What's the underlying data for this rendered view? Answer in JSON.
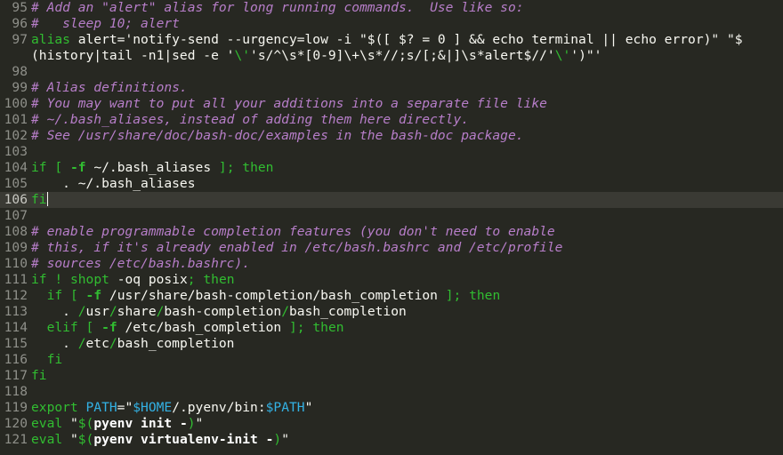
{
  "editor": {
    "language": "bash",
    "current_line": 106,
    "colors": {
      "background": "#272822",
      "current_line_bg": "#3a3a34",
      "gutter_text": "#8f908a",
      "text": "#f8f8f2",
      "comment": "#b77ec9",
      "keyword": "#31bd31",
      "string_literal": "#dcdcaa",
      "variable": "#33b2e5",
      "command_bold": "#ffffff"
    }
  },
  "lines": [
    {
      "num": "95",
      "segments": [
        {
          "t": "comment",
          "text": "# Add an \"alert\" alias for long running commands.  Use like so:"
        }
      ]
    },
    {
      "num": "96",
      "segments": [
        {
          "t": "comment",
          "text": "#   sleep 10; alert"
        }
      ]
    },
    {
      "num": "97",
      "segments": [
        {
          "t": "keyword",
          "text": "alias"
        },
        {
          "t": "plain",
          "text": " alert='notify-send --urgency=low -i \"$([ $? = 0 ] && echo terminal || echo error)\" \"$"
        }
      ]
    },
    {
      "num": "",
      "segments": [
        {
          "t": "plain",
          "text": "(history|tail -n1|sed -e '"
        },
        {
          "t": "keyword",
          "text": "\\'"
        },
        {
          "t": "plain",
          "text": "'s/^\\s*[0-9]\\+\\s*//;s/[;&|]\\s*alert$//'"
        },
        {
          "t": "keyword",
          "text": "\\'"
        },
        {
          "t": "plain",
          "text": "')\"'"
        }
      ]
    },
    {
      "num": "98",
      "segments": []
    },
    {
      "num": "99",
      "segments": [
        {
          "t": "comment",
          "text": "# Alias definitions."
        }
      ]
    },
    {
      "num": "100",
      "segments": [
        {
          "t": "comment",
          "text": "# You may want to put all your additions into a separate file like"
        }
      ]
    },
    {
      "num": "101",
      "segments": [
        {
          "t": "comment",
          "text": "# ~/.bash_aliases, instead of adding them here directly."
        }
      ]
    },
    {
      "num": "102",
      "segments": [
        {
          "t": "comment",
          "text": "# See /usr/share/doc/bash-doc/examples in the bash-doc package."
        }
      ]
    },
    {
      "num": "103",
      "segments": []
    },
    {
      "num": "104",
      "segments": [
        {
          "t": "keyword",
          "text": "if"
        },
        {
          "t": "plain",
          "text": " "
        },
        {
          "t": "keyword",
          "text": "["
        },
        {
          "t": "plain",
          "text": " "
        },
        {
          "t": "flag",
          "text": "-f"
        },
        {
          "t": "plain",
          "text": " ~/.bash_aliases "
        },
        {
          "t": "keyword",
          "text": "];"
        },
        {
          "t": "plain",
          "text": " "
        },
        {
          "t": "keyword",
          "text": "then"
        }
      ]
    },
    {
      "num": "105",
      "segments": [
        {
          "t": "plain",
          "text": "    . ~/.bash_aliases"
        }
      ]
    },
    {
      "num": "106",
      "segments": [
        {
          "t": "keyword",
          "text": "fi"
        }
      ]
    },
    {
      "num": "107",
      "segments": []
    },
    {
      "num": "108",
      "segments": [
        {
          "t": "comment",
          "text": "# enable programmable completion features (you don't need to enable"
        }
      ]
    },
    {
      "num": "109",
      "segments": [
        {
          "t": "comment",
          "text": "# this, if it's already enabled in /etc/bash.bashrc and /etc/profile"
        }
      ]
    },
    {
      "num": "110",
      "segments": [
        {
          "t": "comment",
          "text": "# sources /etc/bash.bashrc)."
        }
      ]
    },
    {
      "num": "111",
      "segments": [
        {
          "t": "keyword",
          "text": "if"
        },
        {
          "t": "plain",
          "text": " "
        },
        {
          "t": "keyword",
          "text": "!"
        },
        {
          "t": "plain",
          "text": " "
        },
        {
          "t": "keyword",
          "text": "shopt"
        },
        {
          "t": "plain",
          "text": " -oq posix"
        },
        {
          "t": "keyword",
          "text": ";"
        },
        {
          "t": "plain",
          "text": " "
        },
        {
          "t": "keyword",
          "text": "then"
        }
      ]
    },
    {
      "num": "112",
      "segments": [
        {
          "t": "plain",
          "text": "  "
        },
        {
          "t": "keyword",
          "text": "if"
        },
        {
          "t": "plain",
          "text": " "
        },
        {
          "t": "keyword",
          "text": "["
        },
        {
          "t": "plain",
          "text": " "
        },
        {
          "t": "flag",
          "text": "-f"
        },
        {
          "t": "plain",
          "text": " /usr/share/bash-completion/bash_completion "
        },
        {
          "t": "keyword",
          "text": "];"
        },
        {
          "t": "plain",
          "text": " "
        },
        {
          "t": "keyword",
          "text": "then"
        }
      ]
    },
    {
      "num": "113",
      "segments": [
        {
          "t": "plain",
          "text": "    . "
        },
        {
          "t": "keyword",
          "text": "/"
        },
        {
          "t": "plain",
          "text": "usr"
        },
        {
          "t": "keyword",
          "text": "/"
        },
        {
          "t": "plain",
          "text": "share"
        },
        {
          "t": "keyword",
          "text": "/"
        },
        {
          "t": "plain",
          "text": "bash-completion"
        },
        {
          "t": "keyword",
          "text": "/"
        },
        {
          "t": "plain",
          "text": "bash_completion"
        }
      ]
    },
    {
      "num": "114",
      "segments": [
        {
          "t": "plain",
          "text": "  "
        },
        {
          "t": "keyword",
          "text": "elif"
        },
        {
          "t": "plain",
          "text": " "
        },
        {
          "t": "keyword",
          "text": "["
        },
        {
          "t": "plain",
          "text": " "
        },
        {
          "t": "flag",
          "text": "-f"
        },
        {
          "t": "plain",
          "text": " /etc/bash_completion "
        },
        {
          "t": "keyword",
          "text": "];"
        },
        {
          "t": "plain",
          "text": " "
        },
        {
          "t": "keyword",
          "text": "then"
        }
      ]
    },
    {
      "num": "115",
      "segments": [
        {
          "t": "plain",
          "text": "    . "
        },
        {
          "t": "keyword",
          "text": "/"
        },
        {
          "t": "plain",
          "text": "etc"
        },
        {
          "t": "keyword",
          "text": "/"
        },
        {
          "t": "plain",
          "text": "bash_completion"
        }
      ]
    },
    {
      "num": "116",
      "segments": [
        {
          "t": "plain",
          "text": "  "
        },
        {
          "t": "keyword",
          "text": "fi"
        }
      ]
    },
    {
      "num": "117",
      "segments": [
        {
          "t": "keyword",
          "text": "fi"
        }
      ]
    },
    {
      "num": "118",
      "segments": []
    },
    {
      "num": "119",
      "segments": [
        {
          "t": "keyword",
          "text": "export"
        },
        {
          "t": "plain",
          "text": " "
        },
        {
          "t": "variable",
          "text": "PATH"
        },
        {
          "t": "plain",
          "text": "=\""
        },
        {
          "t": "variable",
          "text": "$HOME"
        },
        {
          "t": "plain",
          "text": "/.pyenv/bin:"
        },
        {
          "t": "variable",
          "text": "$PATH"
        },
        {
          "t": "plain",
          "text": "\""
        }
      ]
    },
    {
      "num": "120",
      "segments": [
        {
          "t": "keyword",
          "text": "eval"
        },
        {
          "t": "plain",
          "text": " \""
        },
        {
          "t": "keyword",
          "text": "$("
        },
        {
          "t": "command",
          "text": "pyenv init -"
        },
        {
          "t": "keyword",
          "text": ")"
        },
        {
          "t": "plain",
          "text": "\""
        }
      ]
    },
    {
      "num": "121",
      "segments": [
        {
          "t": "keyword",
          "text": "eval"
        },
        {
          "t": "plain",
          "text": " \""
        },
        {
          "t": "keyword",
          "text": "$("
        },
        {
          "t": "command",
          "text": "pyenv virtualenv-init -"
        },
        {
          "t": "keyword",
          "text": ")"
        },
        {
          "t": "plain",
          "text": "\""
        }
      ]
    }
  ]
}
